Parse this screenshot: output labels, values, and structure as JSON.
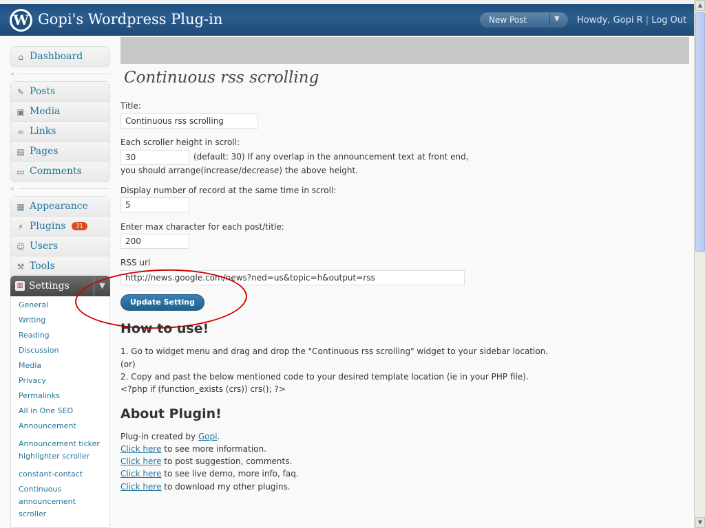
{
  "header": {
    "site_title": "Gopi's Wordpress Plug-in",
    "new_post_label": "New Post",
    "howdy_text": "Howdy, Gopi R",
    "separator": "|",
    "logout_label": "Log Out"
  },
  "sidebar": {
    "dashboard": "Dashboard",
    "group1": [
      "Posts",
      "Media",
      "Links",
      "Pages",
      "Comments"
    ],
    "group2": {
      "appearance": "Appearance",
      "plugins": "Plugins",
      "plugins_badge": "31",
      "users": "Users",
      "tools": "Tools"
    },
    "settings_label": "Settings",
    "submenu": [
      "General",
      "Writing",
      "Reading",
      "Discussion",
      "Media",
      "Privacy",
      "Permalinks",
      "All in One SEO",
      "Announcement",
      "Announcement ticker highlighter scroller",
      "constant-contact",
      "Continuous announcement scroller"
    ]
  },
  "main": {
    "page_title": "Continuous rss scrolling",
    "title_label": "Title:",
    "title_value": "Continuous rss scrolling",
    "height_label": "Each scroller height in scroll:",
    "height_value": "30",
    "height_note_1": "(default: 30) If any overlap in the announcement text at front end,",
    "height_note_2": "you should arrange(increase/decrease) the above height.",
    "display_label": "Display number of record at the same time in scroll:",
    "display_value": "5",
    "maxchar_label": "Enter max character for each post/title:",
    "maxchar_value": "200",
    "rss_label": "RSS url",
    "rss_value": "http://news.google.com/news?ned=us&topic=h&output=rss",
    "update_button": "Update Setting",
    "howto_heading": "How to use!",
    "howto_1": "1. Go to widget menu and drag and drop the \"Continuous rss scrolling\" widget to your sidebar location.",
    "howto_or": "(or)",
    "howto_2": "2. Copy and past the below mentioned code to your desired template location (ie in your PHP file).",
    "howto_code": "<?php if (function_exists (crs)) crs(); ?>",
    "about_heading": "About Plugin!",
    "created_by": "Plug-in created by",
    "author_link": "Gopi",
    "period": ".",
    "click_here": "Click here",
    "about_1": "to see more information.",
    "about_2": "to post suggestion, comments.",
    "about_3": "to see live demo, more info, faq.",
    "about_4": "to download my other plugins."
  }
}
